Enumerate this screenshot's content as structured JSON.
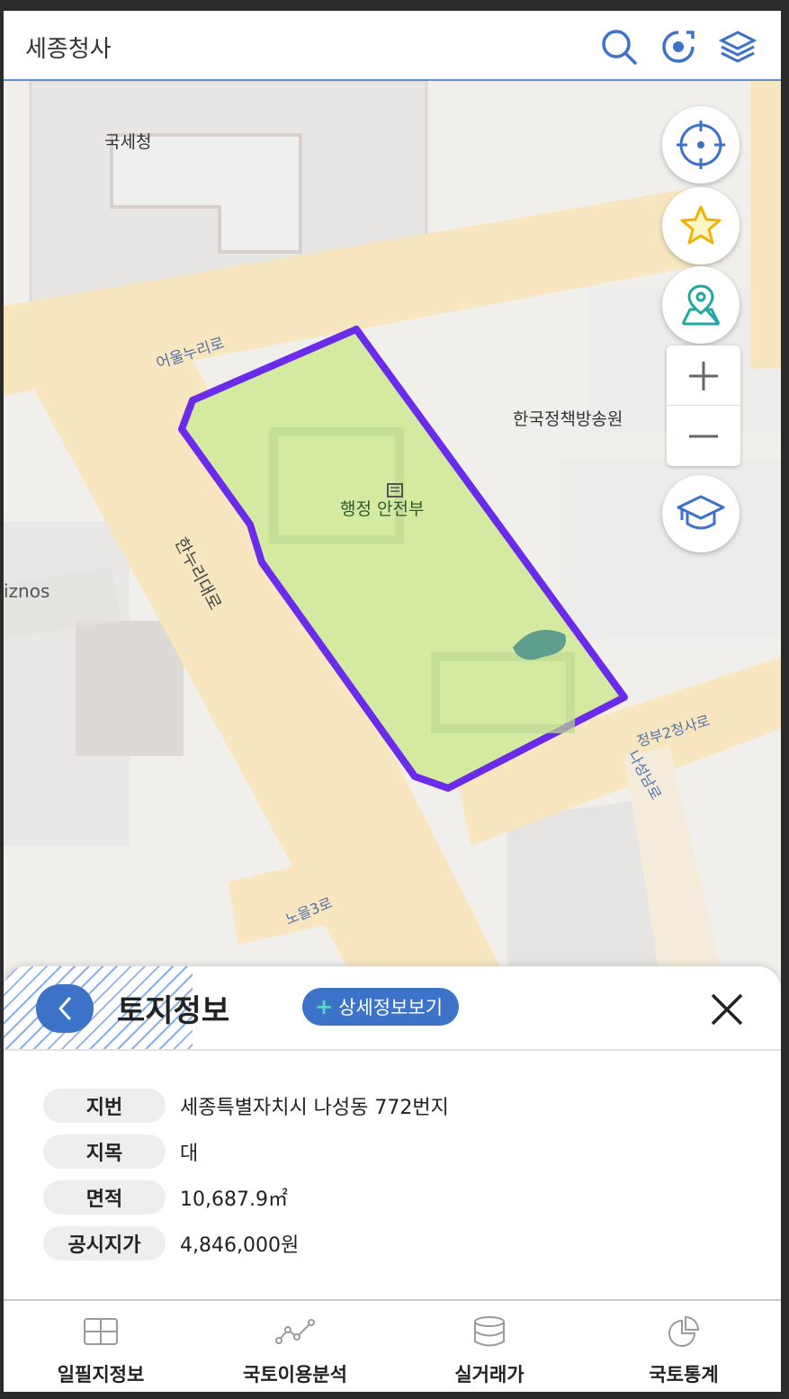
{
  "search": {
    "query": "세종청사"
  },
  "map": {
    "labels": {
      "nts": "국세청",
      "road_eoul": "어울누리로",
      "ktv": "한국정책방송원",
      "mois": "행정 안전부",
      "hannuri": "한누리대로",
      "iznos": "iznos",
      "jeongbu": "정부2청사로",
      "naseongnam": "나성남로",
      "noeul": "노을3로"
    },
    "colors": {
      "parcel_fill": "#d3eaa0",
      "parcel_outline": "#6a2bea",
      "road": "#f8e6c0",
      "accent": "#3d72c9"
    }
  },
  "controls": [
    "current-location",
    "favorites",
    "location-map",
    "zoom-in",
    "zoom-out",
    "education"
  ],
  "sheet": {
    "title": "토지정보",
    "detail_button": "상세정보보기",
    "detail_plus": "+",
    "rows": [
      {
        "label": "지번",
        "value": "세종특별자치시 나성동 772번지"
      },
      {
        "label": "지목",
        "value": "대"
      },
      {
        "label": "면적",
        "value": "10,687.9㎡"
      },
      {
        "label": "공시지가",
        "value": "4,846,000원"
      }
    ]
  },
  "nav": {
    "items": [
      {
        "label": "일필지정보",
        "icon": "grid-icon"
      },
      {
        "label": "국토이용분석",
        "icon": "line-chart-icon"
      },
      {
        "label": "실거래가",
        "icon": "database-icon"
      },
      {
        "label": "국토통계",
        "icon": "pie-chart-icon"
      }
    ]
  }
}
